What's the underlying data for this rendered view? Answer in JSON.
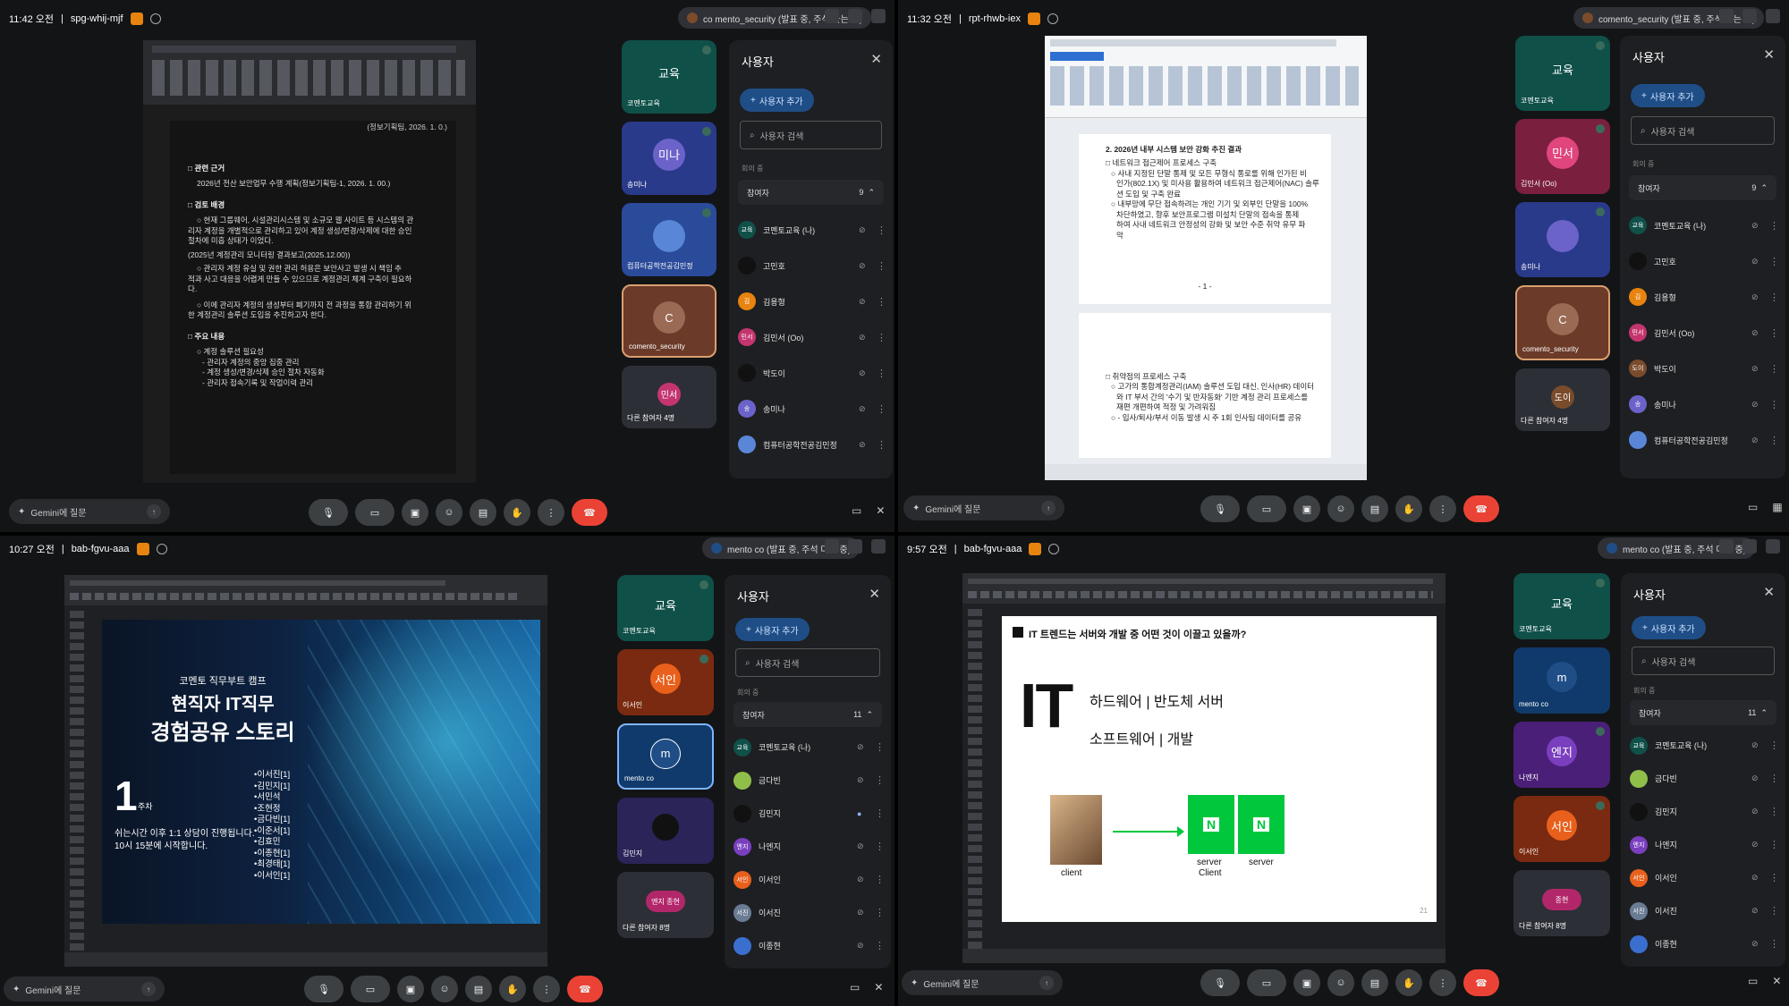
{
  "q1": {
    "time": "11:42 오전",
    "code": "spg-whij-mjf",
    "pill": "co mento_security (발표 중, 주석 다는 중)",
    "doc": {
      "rev": "(정보기획팀, 2026. 1. 0.)",
      "s1": "□ 관련 근거",
      "s1a": "2026년 전산 보안업무 수행 계획(정보기획팀-1, 2026. 1. 00.)",
      "s2": "□ 검토 배경",
      "s2a": "○ 현재 그룹웨어, 시설관리시스템 및 소규모 웹 사이트 등 시스템의 관",
      "s2b": "리자 계정을 개별적으로 관리하고 있어 계정 생성/변경/삭제에 대한 승인",
      "s2c": "절차에 미흡 상태가 이었다.",
      "s2d": "(2025년 계정관리 모니터링 결과보고(2025.12.00))",
      "s2e": "○ 관리자 계정 유실 및 권한 관리 허용은 보안사고 발생 시 책임 추",
      "s2f": "적과 사고 대응을 어렵게 만들 수 있으므로 계정관리 체계 구축이 필요하",
      "s2g": "다.",
      "s2h": "○ 이에 관리자 계정의 생성부터 폐기까지 전 과정을 통합 관리하기 위",
      "s2i": "한 계정관리 솔루션 도입을 추진하고자 한다.",
      "s3": "□ 주요 내용",
      "s3a": "○ 계정 솔루션 필요성",
      "s3b": "- 관리자 계정의 중앙 집중 관리",
      "s3c": "- 계정 생성/변경/삭제 승인 절차 자동화",
      "s3d": "- 관리자 접속기록 및 작업이력 관리"
    },
    "tiles": [
      {
        "label": "교육",
        "name": "코멘토교육"
      },
      {
        "label": "미나",
        "name": "송미나"
      },
      {
        "label": "",
        "name": "컴퓨터공학전공김민정"
      },
      {
        "label": "C",
        "name": "comento_security"
      },
      {
        "label": "민서",
        "name": "다른 참여자 4명"
      }
    ],
    "panel": {
      "title": "사용자",
      "add": "사용자 추가",
      "search": "사용자 검색",
      "sec": "회의 중",
      "grp": "참여자",
      "count": "9",
      "people": [
        {
          "av": "교육",
          "name": "코멘토교육 (나)"
        },
        {
          "av": "",
          "name": "고민호"
        },
        {
          "av": "김",
          "name": "김용형"
        },
        {
          "av": "민서",
          "name": "김민서 (Oo)"
        },
        {
          "av": "",
          "name": "박도이"
        },
        {
          "av": "송",
          "name": "송미나"
        },
        {
          "av": "",
          "name": "컴퓨터공학전공김민정"
        }
      ]
    },
    "gemini": "Gemini에 질문"
  },
  "q2": {
    "time": "11:32 오전",
    "code": "rpt-rhwb-iex",
    "pill": "comento_security (발표 중, 주석 다는 중)",
    "doc": {
      "h": "2. 2026년 내부 시스템 보안 강화 추진 결과",
      "a": "□ 네트워크 접근제어 프로세스 구축",
      "b": "○ 사내 지정된 단말 통제 및 모든 무형식 통로를 위해 인가된 비",
      "c": "인가(802.1X) 및 미사용 활용하여 네트워크 접근제어(NAC) 솔루",
      "d": "션 도입 및 구축 완료",
      "e": "○ 내부망에 무단 접속하려는 개인 기기 및 외부인 단말을 100%",
      "f": "차단하였고, 향후 보안프로그램 미설치 단말의 접속을 통제",
      "g": "하여 사내 네트워크 안정성의 강화 및 보안 수준 취약 유무 파",
      "h2": "악",
      "p": "- 1 -",
      "k": "□ 취약점의 프로세스 구축",
      "l": "○ 고가의 통합계정관리(IAM) 솔루션 도입 대신, 인사(HR) 데이터",
      "m": "와 IT 부서 간의 '수기 및 반자동화' 기반 계정 관리 프로세스를",
      "n": "재편 개편하여 적정 및 가려워짐",
      "o": "○ - 입사/퇴사/부서 이동 발생 시 주 1회 인사팀 데이터를 공유"
    },
    "tiles": [
      {
        "label": "교육",
        "name": "코멘토교육"
      },
      {
        "label": "민서",
        "name": "김민서 (Oo)"
      },
      {
        "label": "",
        "name": "송미나"
      },
      {
        "label": "C",
        "name": "comento_security"
      },
      {
        "label": "도이",
        "name": "다른 참여자 4명"
      }
    ],
    "panel": {
      "title": "사용자",
      "add": "사용자 추가",
      "search": "사용자 검색",
      "sec": "회의 중",
      "grp": "참여자",
      "count": "9",
      "people": [
        {
          "av": "교육",
          "name": "코멘토교육 (나)"
        },
        {
          "av": "",
          "name": "고민호"
        },
        {
          "av": "김",
          "name": "김용형"
        },
        {
          "av": "민서",
          "name": "김민서 (Oo)"
        },
        {
          "av": "도이",
          "name": "박도이"
        },
        {
          "av": "송",
          "name": "송미나"
        },
        {
          "av": "",
          "name": "컴퓨터공학전공김민정"
        }
      ]
    },
    "gemini": "Gemini에 질문"
  },
  "q3": {
    "time": "10:27 오전",
    "code": "bab-fgvu-aaa",
    "pill": "mento co (발표 중, 주석 다는 중)",
    "slide": {
      "sub": "코멘토 직무부트 캠프",
      "t1": "현직자 IT직무",
      "t2": "경험공유 스토리",
      "num": "1",
      "wk": "주차",
      "n1": "쉬는시간 이후 1:1 상담이 진행됩니다.",
      "n2": "10시 15분에 시작합니다.",
      "names": [
        "•이서진[1]",
        "•김민지[1]",
        "•서민석",
        "•조현정",
        "•금다빈[1]",
        "•이준서[1]",
        "•김효민",
        "•이종현[1]",
        "•최경태[1]",
        "•이서인[1]"
      ]
    },
    "tiles": [
      {
        "label": "교육",
        "name": "코멘토교육"
      },
      {
        "label": "서인",
        "name": "이서인"
      },
      {
        "label": "m",
        "name": "mento co"
      },
      {
        "label": "",
        "name": "김민지"
      },
      {
        "label": "엔지 종현",
        "name": "다른 참여자 8명"
      }
    ],
    "panel": {
      "title": "사용자",
      "add": "사용자 추가",
      "search": "사용자 검색",
      "sec": "회의 중",
      "grp": "참여자",
      "count": "11",
      "people": [
        {
          "av": "교육",
          "name": "코멘토교육 (나)"
        },
        {
          "av": "",
          "name": "금다빈"
        },
        {
          "av": "",
          "name": "김민지"
        },
        {
          "av": "엔지",
          "name": "나엔지"
        },
        {
          "av": "서인",
          "name": "이서인"
        },
        {
          "av": "서진",
          "name": "이서진"
        },
        {
          "av": "",
          "name": "이종현"
        }
      ]
    },
    "gemini": "Gemini에 질문"
  },
  "q4": {
    "time": "9:57 오전",
    "code": "bab-fgvu-aaa",
    "pill": "mento co (발표 중, 주석 다는 중)",
    "slide": {
      "q": "IT 트렌드는 서버와 개발 중 어떤 것이 이끌고 있을까?",
      "it": "IT",
      "l1": "하드웨어 | 반도체 서버",
      "l2": "소프트웨어 | 개발",
      "client": "client",
      "server1": "server",
      "client2": "Client",
      "server2": "server",
      "n": "N",
      "page": "21"
    },
    "tiles": [
      {
        "label": "교육",
        "name": "코멘토교육"
      },
      {
        "label": "m",
        "name": "mento co"
      },
      {
        "label": "엔지",
        "name": "나엔지"
      },
      {
        "label": "서인",
        "name": "이서인"
      },
      {
        "label": "종현",
        "name": "다른 참여자 8명"
      }
    ],
    "panel": {
      "title": "사용자",
      "add": "사용자 추가",
      "search": "사용자 검색",
      "sec": "회의 중",
      "grp": "참여자",
      "count": "11",
      "people": [
        {
          "av": "교육",
          "name": "코멘토교육 (나)"
        },
        {
          "av": "",
          "name": "금다빈"
        },
        {
          "av": "",
          "name": "김민지"
        },
        {
          "av": "엔지",
          "name": "나엔지"
        },
        {
          "av": "서인",
          "name": "이서인"
        },
        {
          "av": "서진",
          "name": "이서진"
        },
        {
          "av": "",
          "name": "이종현"
        }
      ]
    },
    "gemini": "Gemini에 질문"
  },
  "colors": {
    "end": "#ea4335",
    "accent": "#1f4e87",
    "green": "#00c73c"
  }
}
